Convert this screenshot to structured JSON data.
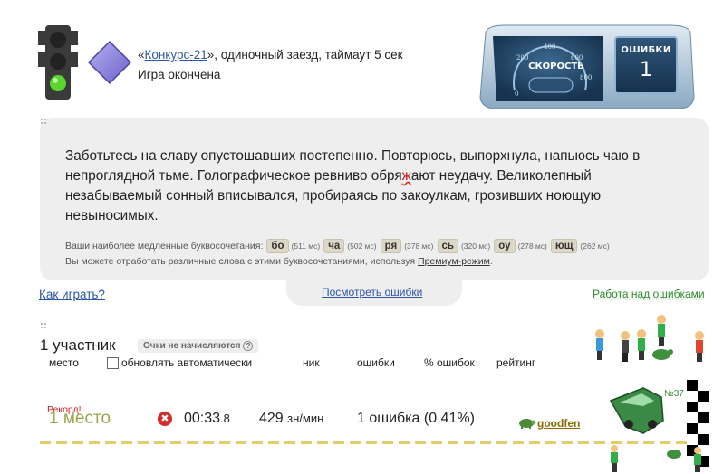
{
  "header": {
    "quote_open": "«",
    "competition_link": "Конкурс-21",
    "race_desc": "», одиночный заезд, таймаут 5 сек",
    "status": "Игра окончена"
  },
  "gauge": {
    "speed_label": "СКОРОСТЬ",
    "ticks": [
      "0",
      "200",
      "400",
      "600",
      "800"
    ],
    "errors_title": "ОШИБКИ",
    "errors_count": "1"
  },
  "text_panel": {
    "text_part1": "Заботьтесь на славу опустошавших постепенно. Повторюсь, выпорхнула, напьюсь чаю в непроглядной тьме. Голографическое ревниво обря",
    "error_letter": "ж",
    "text_part2": "ают неудачу. Великолепный незабываемый сонный вписывался, пробираясь по закоулкам, грозивших ноющую невыносимых.",
    "slow_label": "Ваши наиболее медленные буквосочетания:",
    "slow_combos": [
      {
        "combo": "бо",
        "ms": "(511 мс)"
      },
      {
        "combo": "ча",
        "ms": "(502 мс)"
      },
      {
        "combo": "ря",
        "ms": "(378 мс)"
      },
      {
        "combo": "сь",
        "ms": "(320 мс)"
      },
      {
        "combo": "оу",
        "ms": "(278 мс)"
      },
      {
        "combo": "ющ",
        "ms": "(262 мс)"
      }
    ],
    "premium_text": "Вы можете отработать различные слова с этими буквосочетаниями, используя ",
    "premium_link": "Премиум-режим",
    "premium_end": "."
  },
  "links": {
    "how_to_play": "Как играть?",
    "view_errors": "Посмотреть ошибки",
    "work_on_errors": "Работа над ошибками"
  },
  "participants": {
    "count_label": "1 участник",
    "no_points": "Очки не начисляются",
    "help": "?",
    "col_place": "место",
    "col_auto_update": "обновлять автоматически",
    "col_nick": "ник",
    "col_errors": "ошибки",
    "col_error_pct": "% ошибок",
    "col_rating": "рейтинг"
  },
  "result": {
    "record": "Рекорд!",
    "place": "1 место",
    "error_icon": "✖",
    "time_main": "00:33",
    "time_frac": ".8",
    "speed_value": "429",
    "speed_unit": "зн/мин",
    "errors_text": "1 ошибка (0,41%)",
    "nick": "goodfen",
    "car_number": "№37"
  },
  "colors": {
    "link_blue": "#2b57a8",
    "link_green": "#2a8a2a",
    "place_olive": "#9aa84a",
    "record_red": "#d42020",
    "panel_gray": "#eeeeee"
  }
}
